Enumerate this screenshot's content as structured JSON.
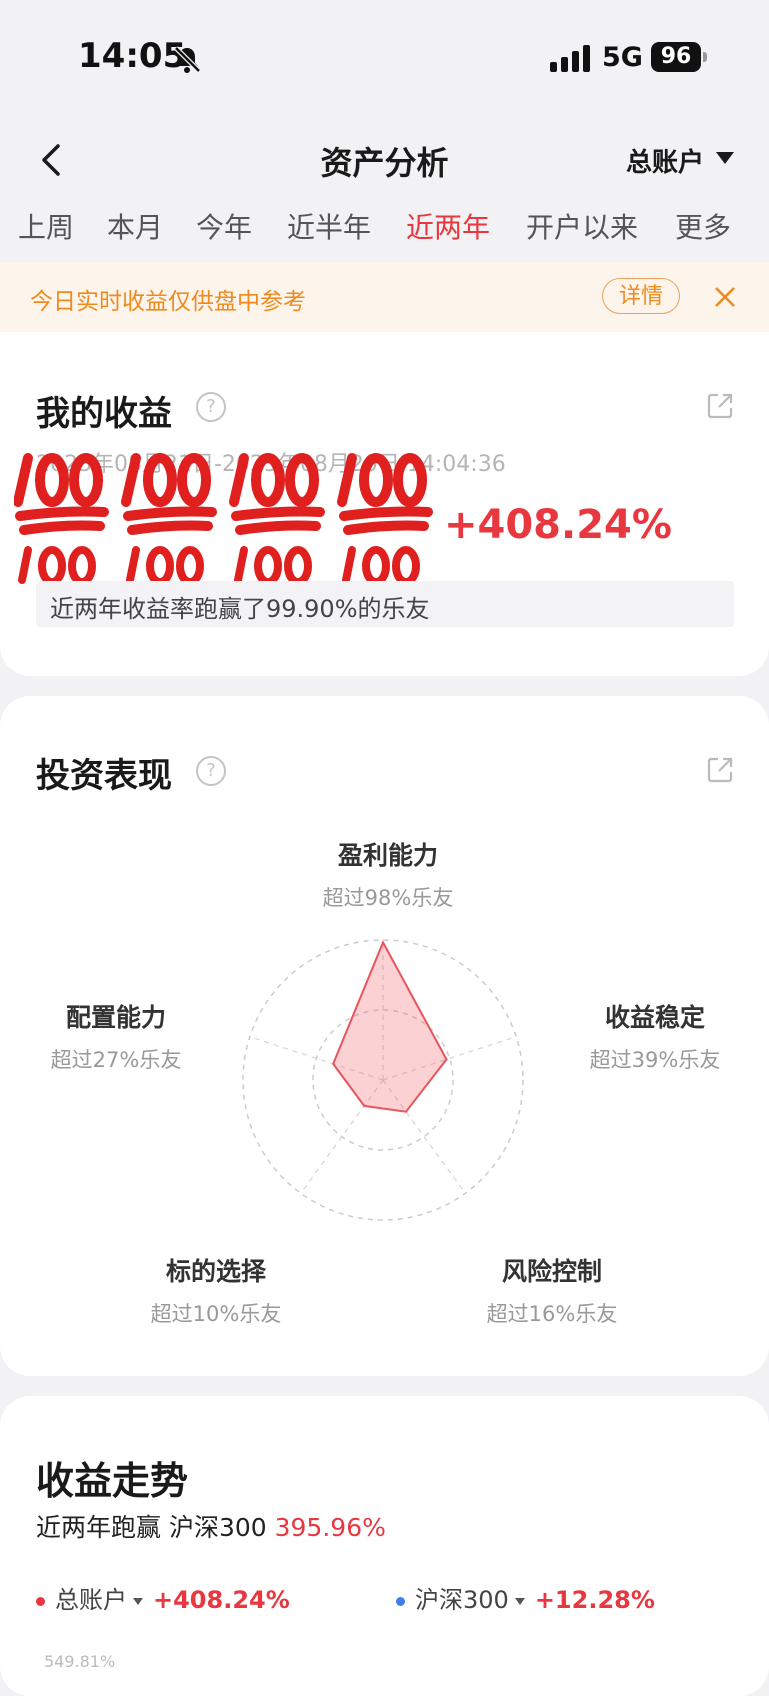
{
  "status": {
    "time": "14:05",
    "network": "5G",
    "battery": "96"
  },
  "nav": {
    "title": "资产分析",
    "account": "总账户"
  },
  "tabs": [
    {
      "label": "上周",
      "active": false
    },
    {
      "label": "本月",
      "active": false
    },
    {
      "label": "今年",
      "active": false
    },
    {
      "label": "近半年",
      "active": false
    },
    {
      "label": "近两年",
      "active": true
    },
    {
      "label": "开户以来",
      "active": false
    },
    {
      "label": "更多",
      "active": false
    }
  ],
  "notice": {
    "text": "今日实时收益仅供盘中参考",
    "button": "详情"
  },
  "earnings": {
    "title": "我的收益",
    "help": "?",
    "period": "2023年08月21日-2025年08月20日 14:04:36",
    "return_pct": "+408.24%",
    "beat": "近两年收益率跑赢了99.90%的乐友"
  },
  "performance": {
    "title": "投资表现",
    "help": "?",
    "axes": [
      {
        "name": "盈利能力",
        "sub": "超过98%乐友",
        "value": 98
      },
      {
        "name": "收益稳定",
        "sub": "超过39%乐友",
        "value": 39
      },
      {
        "name": "风险控制",
        "sub": "超过16%乐友",
        "value": 16
      },
      {
        "name": "标的选择",
        "sub": "超过10%乐友",
        "value": 10
      },
      {
        "name": "配置能力",
        "sub": "超过27%乐友",
        "value": 27
      }
    ]
  },
  "trend": {
    "title": "收益走势",
    "summary_prefix": "近两年跑赢 沪深300 ",
    "summary_pct": "395.96%",
    "legend": [
      {
        "name": "总账户",
        "value": "+408.24%",
        "color": "#e8373f"
      },
      {
        "name": "沪深300",
        "value": "+12.28%",
        "color": "#3d7ff0"
      }
    ],
    "y_tick_top": "549.81%"
  },
  "colors": {
    "accent": "#e8373f",
    "notice": "#f08a1d"
  }
}
